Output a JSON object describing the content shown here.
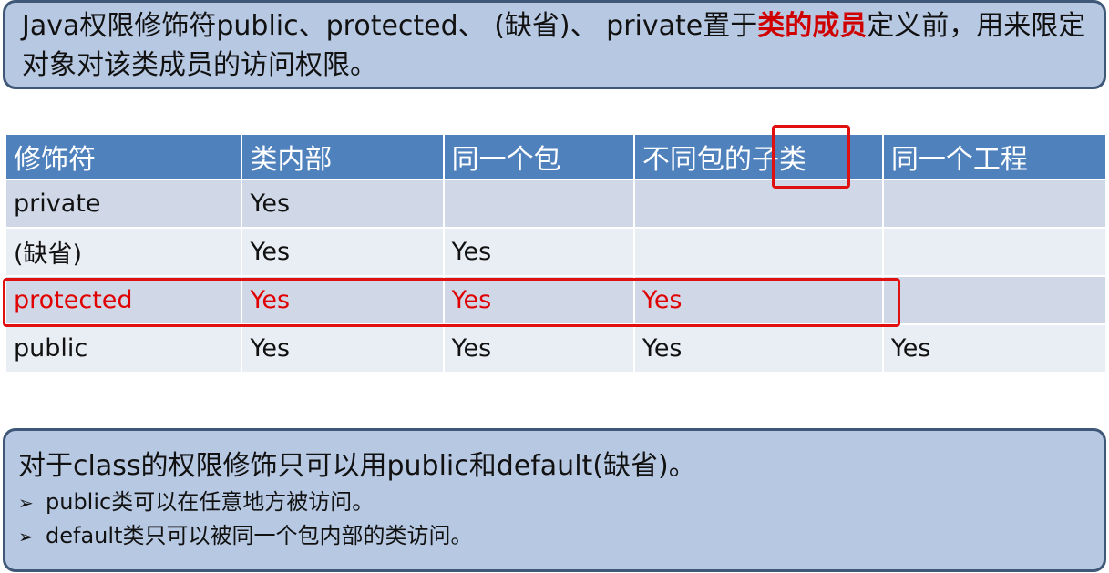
{
  "top_note": {
    "part1": "Java权限修饰符public、protected、 (缺省)、 private置于",
    "highlight": "类的成员",
    "part2": "定义前，用来限定对象对该类成员的访问权限。"
  },
  "table": {
    "headers": [
      "修饰符",
      "类内部",
      "同一个包",
      "不同包的子类",
      "同一个工程"
    ],
    "rows": [
      [
        "private",
        "Yes",
        "",
        "",
        ""
      ],
      [
        "(缺省)",
        "Yes",
        "Yes",
        "",
        ""
      ],
      [
        "protected",
        "Yes",
        "Yes",
        "Yes",
        ""
      ],
      [
        "public",
        "Yes",
        "Yes",
        "Yes",
        "Yes"
      ]
    ]
  },
  "bottom_note": {
    "line1": "对于class的权限修饰只可以用public和default(缺省)。",
    "items": [
      "public类可以在任意地方被访问。",
      "default类只可以被同一个包内部的类访问。"
    ],
    "bullet_icon": "arrow-bullet-icon"
  },
  "colors": {
    "header_bg": "#4f81bd",
    "callout_bg": "#b7c8e2",
    "highlight": "#e01010"
  }
}
